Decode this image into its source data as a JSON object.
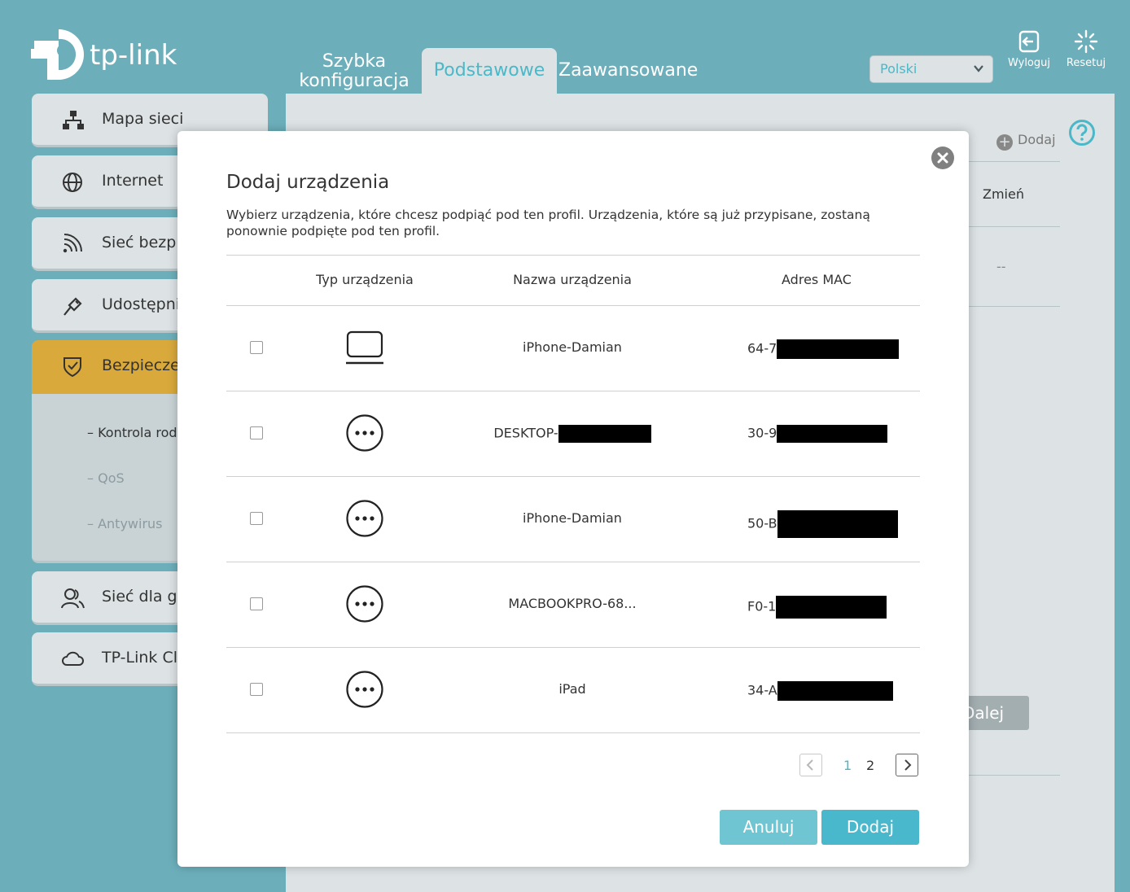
{
  "brand": {
    "logo_text": "tp-link"
  },
  "nav": {
    "quick_setup_line1": "Szybka",
    "quick_setup_line2": "konfiguracja",
    "basic": "Podstawowe",
    "advanced": "Zaawansowane"
  },
  "header": {
    "language": "Polski",
    "logout_label": "Wyloguj",
    "reset_label": "Resetuj"
  },
  "sidebar": {
    "items": [
      {
        "label": "Mapa sieci",
        "icon": "network-map-icon"
      },
      {
        "label": "Internet",
        "icon": "globe-icon"
      },
      {
        "label": "Sieć bezprzewodowa",
        "icon": "wifi-icon"
      },
      {
        "label": "Udostępnianie USB",
        "icon": "usb-icon"
      },
      {
        "label": "Bezpieczeństwo",
        "icon": "shield-icon"
      },
      {
        "label": "Sieć dla gości",
        "icon": "guests-icon"
      },
      {
        "label": "TP-Link Cloud",
        "icon": "cloud-icon"
      }
    ],
    "security_sub": [
      {
        "label": "Kontrola rodzicielska"
      },
      {
        "label": "QoS"
      },
      {
        "label": "Antywirus"
      }
    ]
  },
  "background": {
    "add_label": "Dodaj",
    "edit_label": "Zmień",
    "dash": "--",
    "next_label": "Dalej"
  },
  "modal": {
    "title": "Dodaj urządzenia",
    "description": "Wybierz urządzenia, które chcesz podpiąć pod ten profil. Urządzenia, które są już przypisane, zostaną ponownie podpięte pod ten profil.",
    "columns": {
      "type": "Typ urządzenia",
      "name": "Nazwa urządzenia",
      "mac": "Adres MAC"
    },
    "rows": [
      {
        "type_icon": "laptop-icon",
        "name": "iPhone-Damian",
        "mac_prefix": "64-7",
        "checked": false
      },
      {
        "type_icon": "more-icon",
        "name": "DESKTOP-",
        "mac_prefix": "30-9",
        "checked": false
      },
      {
        "type_icon": "more-icon",
        "name": "iPhone-Damian",
        "mac_prefix": "50-B",
        "checked": false
      },
      {
        "type_icon": "more-icon",
        "name": "MACBOOKPRO-68...",
        "mac_prefix": "F0-1",
        "checked": false
      },
      {
        "type_icon": "more-icon",
        "name": "iPad",
        "mac_prefix": "34-A",
        "checked": false
      }
    ],
    "pagination": {
      "pages": [
        "1",
        "2"
      ],
      "current": "1"
    },
    "cancel_label": "Anuluj",
    "add_label": "Dodaj"
  },
  "colors": {
    "background": "#6cafbb",
    "panel": "#dde3e5",
    "accent": "#4ab8c8",
    "security_active": "#d9a93c",
    "button": "#4ab8cc"
  }
}
